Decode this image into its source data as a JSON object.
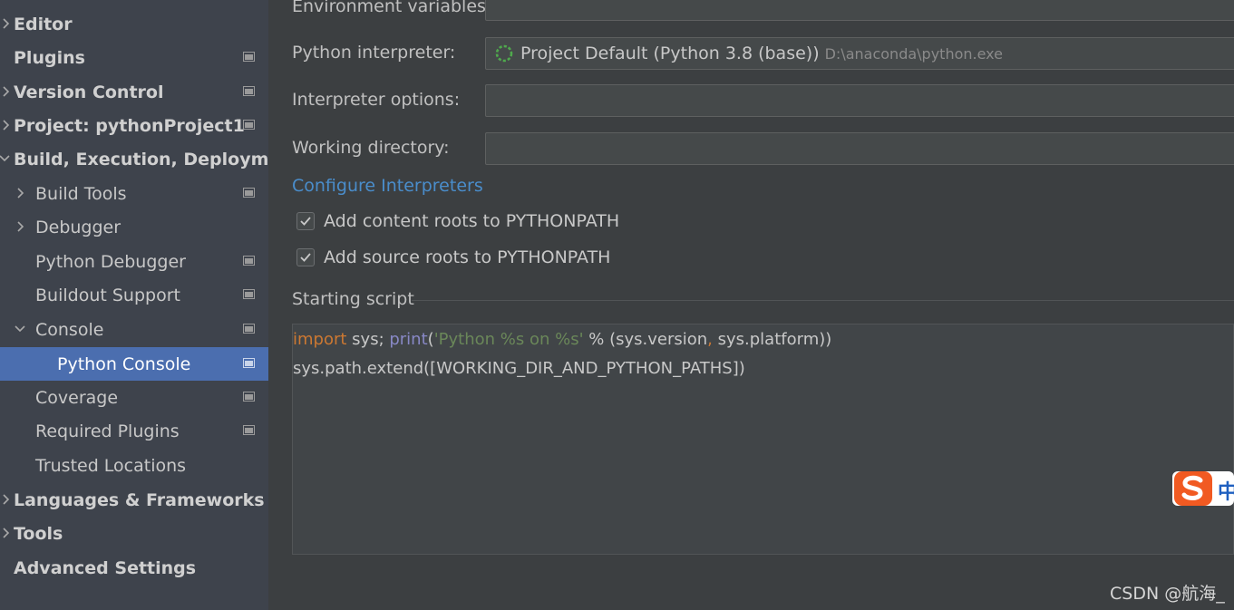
{
  "sidebar": {
    "items": [
      {
        "label": "Editor"
      },
      {
        "label": "Plugins"
      },
      {
        "label": "Version Control"
      },
      {
        "label": "Project: pythonProject1"
      },
      {
        "label": "Build, Execution, Deployment"
      },
      {
        "label": "Build Tools"
      },
      {
        "label": "Debugger"
      },
      {
        "label": "Python Debugger"
      },
      {
        "label": "Buildout Support"
      },
      {
        "label": "Console"
      },
      {
        "label": "Python Console"
      },
      {
        "label": "Coverage"
      },
      {
        "label": "Required Plugins"
      },
      {
        "label": "Trusted Locations"
      },
      {
        "label": "Languages & Frameworks"
      },
      {
        "label": "Tools"
      },
      {
        "label": "Advanced Settings"
      }
    ]
  },
  "form": {
    "env_vars_label": "Environment variables:",
    "interpreter_label": "Python interpreter:",
    "interpreter_value": "Project Default (Python 3.8 (base))",
    "interpreter_path": "D:\\anaconda\\python.exe",
    "interp_options_label": "Interpreter options:",
    "working_dir_label": "Working directory:",
    "configure_link": "Configure Interpreters",
    "add_content_roots": "Add content roots to PYTHONPATH",
    "add_source_roots": "Add source roots to PYTHONPATH",
    "starting_script_label": "Starting script"
  },
  "script": {
    "line1": {
      "kw_import": "import",
      "t1": " sys; ",
      "fn_print": "print",
      "t2": "(",
      "str": "'Python %s on %s'",
      "t3": " % (sys.version",
      "comma": ",",
      "t4": " sys.platform))"
    },
    "line2": "sys.path.extend([WORKING_DIR_AND_PYTHON_PATHS])"
  },
  "ime": {
    "char": "中"
  },
  "watermark": "CSDN @航海_",
  "colors": {
    "selection": "#4b6eaf",
    "link": "#4a8dcb",
    "keyword": "#cc7832",
    "builtin": "#8888c6",
    "string": "#6a8759",
    "ime_brand": "#f15a22"
  }
}
